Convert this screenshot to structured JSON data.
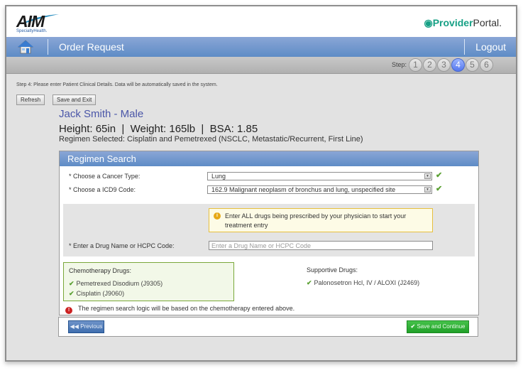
{
  "header": {
    "logo_text": "AIM",
    "logo_subtext": "SpecialtyHealth.",
    "portal_bold": "Provider",
    "portal_normal": "Portal.",
    "portal_icon": "cursor-target-icon"
  },
  "nav": {
    "home_icon": "home-icon",
    "title": "Order Request",
    "logout_label": "Logout"
  },
  "steps": {
    "label": "Step:",
    "items": [
      "1",
      "2",
      "3",
      "4",
      "5",
      "6"
    ],
    "active": "4"
  },
  "instructions": "Step 4: Please enter Patient Clinical Details. Data will be automatically saved in the system.",
  "toolbar": {
    "refresh_label": "Refresh",
    "save_exit_label": "Save and Exit"
  },
  "patient": {
    "name": "Jack Smith - Male",
    "vitals": "Height: 65in  |  Weight: 165lb  |  BSA: 1.85",
    "regimen_selected": "Regimen Selected: Cisplatin and Pemetrexed (NSCLC, Metastatic/Recurrent, First Line)"
  },
  "regimen_search": {
    "title": "Regimen Search",
    "cancer_type_label": "* Choose a Cancer Type:",
    "cancer_type_value": "Lung",
    "icd9_label": "* Choose a ICD9 Code:",
    "icd9_value": "162.9 Malignant neoplasm of bronchus and lung, unspecified site",
    "notice": "Enter ALL drugs being prescribed by your physician to start your treatment entry",
    "drug_label": "* Enter a Drug Name or HCPC Code:",
    "drug_placeholder": "Enter a Drug Name or HCPC Code",
    "drug_value": "",
    "chemo_title": "Chemotherapy Drugs:",
    "chemo_drugs": [
      "Pemetrexed Disodium (J9305)",
      "Cisplatin (J9060)"
    ],
    "supportive_title": "Supportive Drugs:",
    "supportive_drugs": [
      "Palonosetron Hcl, IV / ALOXI (J2469)"
    ],
    "warning": "The regimen search logic will be based on the chemotherapy entered above."
  },
  "footer": {
    "previous_label": "Previous",
    "save_continue_label": "Save and Continue"
  },
  "colors": {
    "nav_blue": "#5e8cc6",
    "patient_name": "#4a56a8",
    "check_green": "#5aa032",
    "save_green": "#20a028",
    "notice_border": "#e7c03f",
    "warning_red": "#cc2222"
  }
}
